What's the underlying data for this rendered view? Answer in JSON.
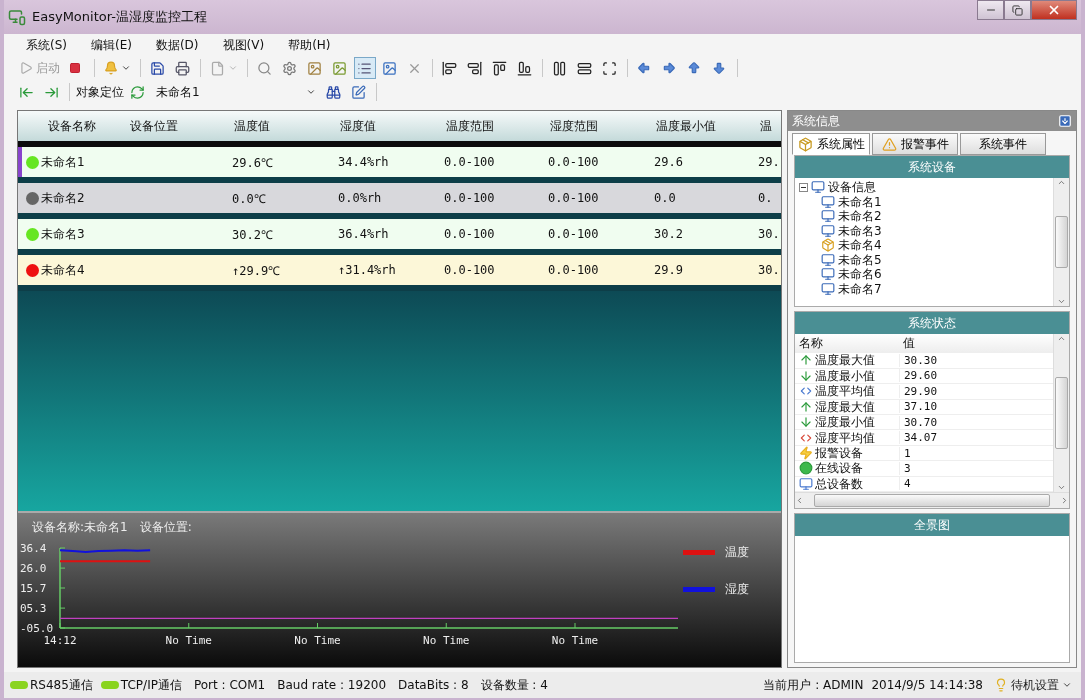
{
  "window": {
    "title": "EasyMonitor-温湿度监控工程"
  },
  "menu": [
    "系统(S)",
    "编辑(E)",
    "数据(D)",
    "视图(V)",
    "帮助(H)"
  ],
  "toolbar": {
    "start": {
      "label": "启动",
      "disabled": true
    },
    "list_view_on": true
  },
  "locate_bar": {
    "label": "对象定位",
    "object_select": {
      "value": "未命名1"
    }
  },
  "table": {
    "columns": [
      "设备名称",
      "设备位置",
      "温度值",
      "湿度值",
      "温度范围",
      "湿度范围",
      "温度最小值",
      "温"
    ],
    "rows": [
      {
        "kind": "online",
        "color": "#66e622",
        "selected": true,
        "cells": [
          "未命名1",
          "",
          "29.6℃",
          "34.4%rh",
          "0.0-100",
          "0.0-100",
          "29.6",
          "29."
        ]
      },
      {
        "kind": "offline",
        "color": "#666666",
        "selected": false,
        "cells": [
          "未命名2",
          "",
          "0.0℃",
          "0.0%rh",
          "0.0-100",
          "0.0-100",
          "0.0",
          "0."
        ]
      },
      {
        "kind": "online",
        "color": "#66e622",
        "selected": false,
        "cells": [
          "未命名3",
          "",
          "30.2℃",
          "36.4%rh",
          "0.0-100",
          "0.0-100",
          "30.2",
          "30."
        ]
      },
      {
        "kind": "alarm",
        "color": "#ee1111",
        "selected": false,
        "cells": [
          "未命名4",
          "",
          "↑29.9℃",
          "↑31.4%rh",
          "0.0-100",
          "0.0-100",
          "29.9",
          "30."
        ]
      }
    ]
  },
  "trend": {
    "device_label": "设备名称:未命名1",
    "location_label": "设备位置:",
    "chart_data": {
      "type": "line",
      "ylim": [
        -5,
        36.4
      ],
      "categories": [
        "14:12",
        null,
        null,
        null,
        null,
        null,
        null,
        null,
        null,
        null,
        "No Time",
        null,
        null,
        null,
        null,
        null,
        null,
        null,
        null,
        null,
        "No Time",
        null,
        null,
        null,
        null,
        null,
        null,
        null,
        null,
        null,
        "No Time",
        null,
        null,
        null,
        null,
        null,
        null,
        null,
        null,
        null,
        "No Time",
        null,
        null,
        null,
        null,
        null,
        null,
        null,
        null
      ],
      "yticks": [
        {
          "value": 36.4,
          "label": "36.4"
        },
        {
          "value": 26,
          "label": "26.0"
        },
        {
          "value": 15.7,
          "label": "15.7"
        },
        {
          "value": 5.3,
          "label": "05.3"
        },
        {
          "value": -5,
          "label": "-05.0"
        }
      ],
      "series": [
        {
          "name": "温度",
          "color": "#dd1111",
          "values": [
            29.6,
            29.6,
            29.5,
            29.6,
            29.6,
            29.6,
            29.6,
            29.6,
            null,
            null,
            null,
            null,
            null,
            null,
            null,
            null,
            null,
            null,
            null,
            null,
            null,
            null,
            null,
            null,
            null,
            null,
            null,
            null,
            null,
            null,
            null,
            null,
            null,
            null,
            null,
            null,
            null,
            null,
            null,
            null,
            null,
            null,
            null,
            null,
            null,
            null,
            null,
            null,
            null
          ]
        },
        {
          "name": "湿度",
          "color": "#1111dd",
          "values": [
            35.2,
            34.8,
            34.3,
            34.8,
            35.0,
            35.2,
            35.0,
            35.2,
            null,
            null,
            null,
            null,
            null,
            null,
            null,
            null,
            null,
            null,
            null,
            null,
            null,
            null,
            null,
            null,
            null,
            null,
            null,
            null,
            null,
            null,
            null,
            null,
            null,
            null,
            null,
            null,
            null,
            null,
            null,
            null,
            null,
            null,
            null,
            null,
            null,
            null,
            null,
            null,
            null
          ]
        },
        {
          "name": null,
          "color": "#c040c0",
          "values": [
            0,
            0,
            0,
            0,
            0,
            0,
            0,
            0,
            0,
            0,
            0,
            0,
            0,
            0,
            0,
            0,
            0,
            0,
            0,
            0,
            0,
            0,
            0,
            0,
            0,
            0,
            0,
            0,
            0,
            0,
            0,
            0,
            0,
            0,
            0,
            0,
            0,
            0,
            0,
            0,
            0,
            0,
            0,
            0,
            0,
            0,
            0,
            0,
            0
          ]
        }
      ]
    }
  },
  "side_panel": {
    "title": "系统信息",
    "tabs": [
      {
        "label": "系统属性",
        "selected": true,
        "kind": "box"
      },
      {
        "label": "报警事件",
        "selected": false,
        "kind": "warning"
      },
      {
        "label": "系统事件",
        "selected": false,
        "kind": "none"
      }
    ],
    "devices": {
      "title": "系统设备",
      "tree": [
        {
          "label": "设备信息",
          "expanded": true,
          "children": [
            {
              "label": "未命名1",
              "alarm": false
            },
            {
              "label": "未命名2",
              "alarm": false
            },
            {
              "label": "未命名3",
              "alarm": false
            },
            {
              "label": "未命名4",
              "alarm": true
            },
            {
              "label": "未命名5",
              "alarm": false
            },
            {
              "label": "未命名6",
              "alarm": false
            },
            {
              "label": "未命名7",
              "alarm": false
            }
          ]
        }
      ]
    },
    "status": {
      "title": "系统状态",
      "columns": [
        "名称",
        "值"
      ],
      "rows": [
        {
          "kind": "up",
          "name": "温度最大值",
          "value": "30.30"
        },
        {
          "kind": "down",
          "name": "温度最小值",
          "value": "29.60"
        },
        {
          "kind": "avg-blue",
          "name": "温度平均值",
          "value": "29.90"
        },
        {
          "kind": "up",
          "name": "湿度最大值",
          "value": "37.10"
        },
        {
          "kind": "down",
          "name": "湿度最小值",
          "value": "30.70"
        },
        {
          "kind": "avg-red",
          "name": "湿度平均值",
          "value": "34.07"
        },
        {
          "kind": "alarm",
          "name": "报警设备",
          "value": "1"
        },
        {
          "kind": "online",
          "name": "在线设备",
          "value": "3"
        },
        {
          "kind": "total",
          "name": "总设备数",
          "value": "4"
        }
      ]
    },
    "overview": {
      "title": "全景图"
    }
  },
  "status_bar": {
    "left": [
      "RS485通信",
      "TCP/IP通信"
    ],
    "items": [
      "Port : COM1",
      "Baud rate  : 19200",
      "DataBits : 8",
      "设备数量 : 4"
    ],
    "user": "当前用户 : ADMIN",
    "time": "2014/9/5 14:14:38",
    "standby": "待机设置"
  }
}
